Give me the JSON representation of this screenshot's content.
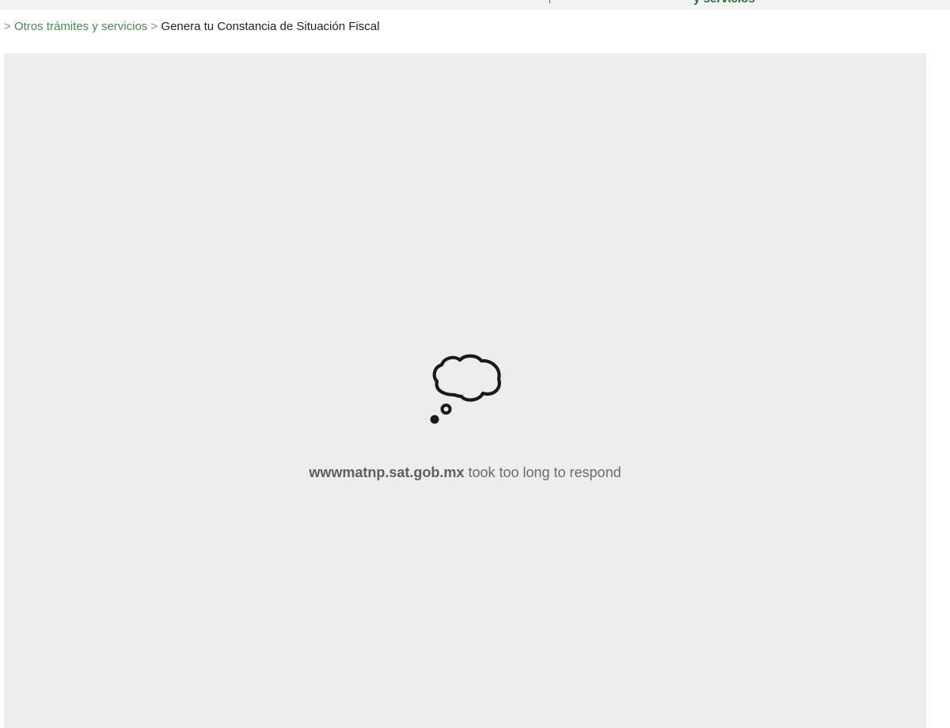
{
  "top_nav": {
    "visible_fragment": "y servicios"
  },
  "breadcrumb": {
    "separator": ">",
    "items": [
      {
        "label": "Otros trámites y servicios",
        "is_link": true
      },
      {
        "label": "Genera tu Constancia de Situación Fiscal",
        "is_link": false
      }
    ]
  },
  "error": {
    "icon": "thought-bubble-icon",
    "host": "wwwmatnp.sat.gob.mx",
    "message": "took too long to respond"
  },
  "colors": {
    "link_green": "#4b8a52",
    "nav_green": "#1f6d34",
    "frame_background": "#ededed"
  }
}
